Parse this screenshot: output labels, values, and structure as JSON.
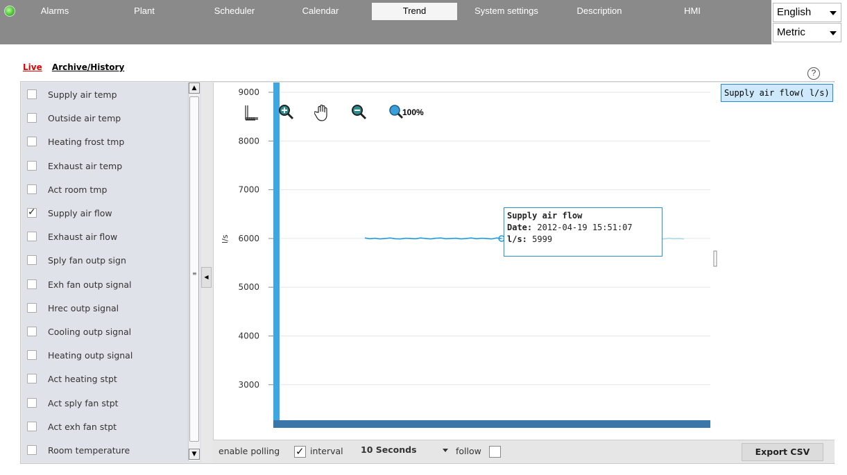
{
  "nav": {
    "tabs": [
      {
        "label": "Alarms"
      },
      {
        "label": "Plant"
      },
      {
        "label": "Scheduler"
      },
      {
        "label": "Calendar"
      },
      {
        "label": "Trend"
      },
      {
        "label": "System settings"
      },
      {
        "label": "Description"
      },
      {
        "label": "HMI"
      }
    ],
    "active_tab": "Trend",
    "language": "English",
    "units": "Metric",
    "status_color": "#4fc43a"
  },
  "modes": {
    "live": "Live",
    "archive": "Archive/History"
  },
  "help_label": "?",
  "signals": [
    {
      "label": "Supply air temp",
      "checked": false
    },
    {
      "label": "Outside air temp",
      "checked": false
    },
    {
      "label": "Heating frost tmp",
      "checked": false
    },
    {
      "label": "Exhaust air temp",
      "checked": false
    },
    {
      "label": "Act room tmp",
      "checked": false
    },
    {
      "label": "Supply air flow",
      "checked": true
    },
    {
      "label": "Exhaust air flow",
      "checked": false
    },
    {
      "label": "Sply fan outp sign",
      "checked": false
    },
    {
      "label": "Exh fan outp signal",
      "checked": false
    },
    {
      "label": "Hrec outp signal",
      "checked": false
    },
    {
      "label": "Cooling outp signal",
      "checked": false
    },
    {
      "label": "Heating outp signal",
      "checked": false
    },
    {
      "label": "Act heating stpt",
      "checked": false
    },
    {
      "label": "Act sply fan stpt",
      "checked": false
    },
    {
      "label": "Act exh fan stpt",
      "checked": false
    },
    {
      "label": "Room temperature",
      "checked": false
    }
  ],
  "toolbar": {
    "zoom_reset_label": "100%"
  },
  "legend_label": "Supply air flow( l/s)",
  "tooltip": {
    "title": "Supply air flow",
    "date_key": "Date:",
    "date_value": "2012-04-19 15:51:07",
    "value_key": "l/s:",
    "value": "5999"
  },
  "chart_data": {
    "type": "line",
    "ylabel": "l/s",
    "yticks": [
      "9000",
      "8000",
      "7000",
      "6000",
      "5000",
      "4000",
      "3000"
    ],
    "ylim": [
      2200,
      9200
    ],
    "series": [
      {
        "name": "Supply air flow",
        "color": "#1d9be0",
        "values": [
          6010,
          5995,
          6005,
          5990,
          6000,
          6010,
          5995,
          5990,
          6005,
          6000,
          5995,
          6010,
          6000,
          5990,
          6005,
          6010,
          5995,
          6000,
          6005,
          5990,
          6000,
          6010,
          5995,
          6005,
          6000,
          5990,
          6010,
          5999,
          6000,
          6005,
          5995,
          6010,
          6000,
          5990,
          6005,
          6000,
          5995,
          6010,
          6000,
          5995,
          6005,
          6000,
          5990,
          6010,
          6000,
          5995,
          6005,
          6000,
          5990,
          6005,
          5995,
          6010,
          6000,
          5990,
          6005,
          6000,
          5995,
          6010,
          6000,
          5990,
          6005,
          5995,
          6000,
          5990
        ]
      }
    ],
    "highlight_index": 27,
    "grid": true
  },
  "bottom": {
    "polling_label": "enable polling",
    "polling_checked": true,
    "interval_label": "interval",
    "interval_value": "10 Seconds",
    "follow_label": "follow",
    "follow_checked": false,
    "export_label": "Export CSV"
  }
}
